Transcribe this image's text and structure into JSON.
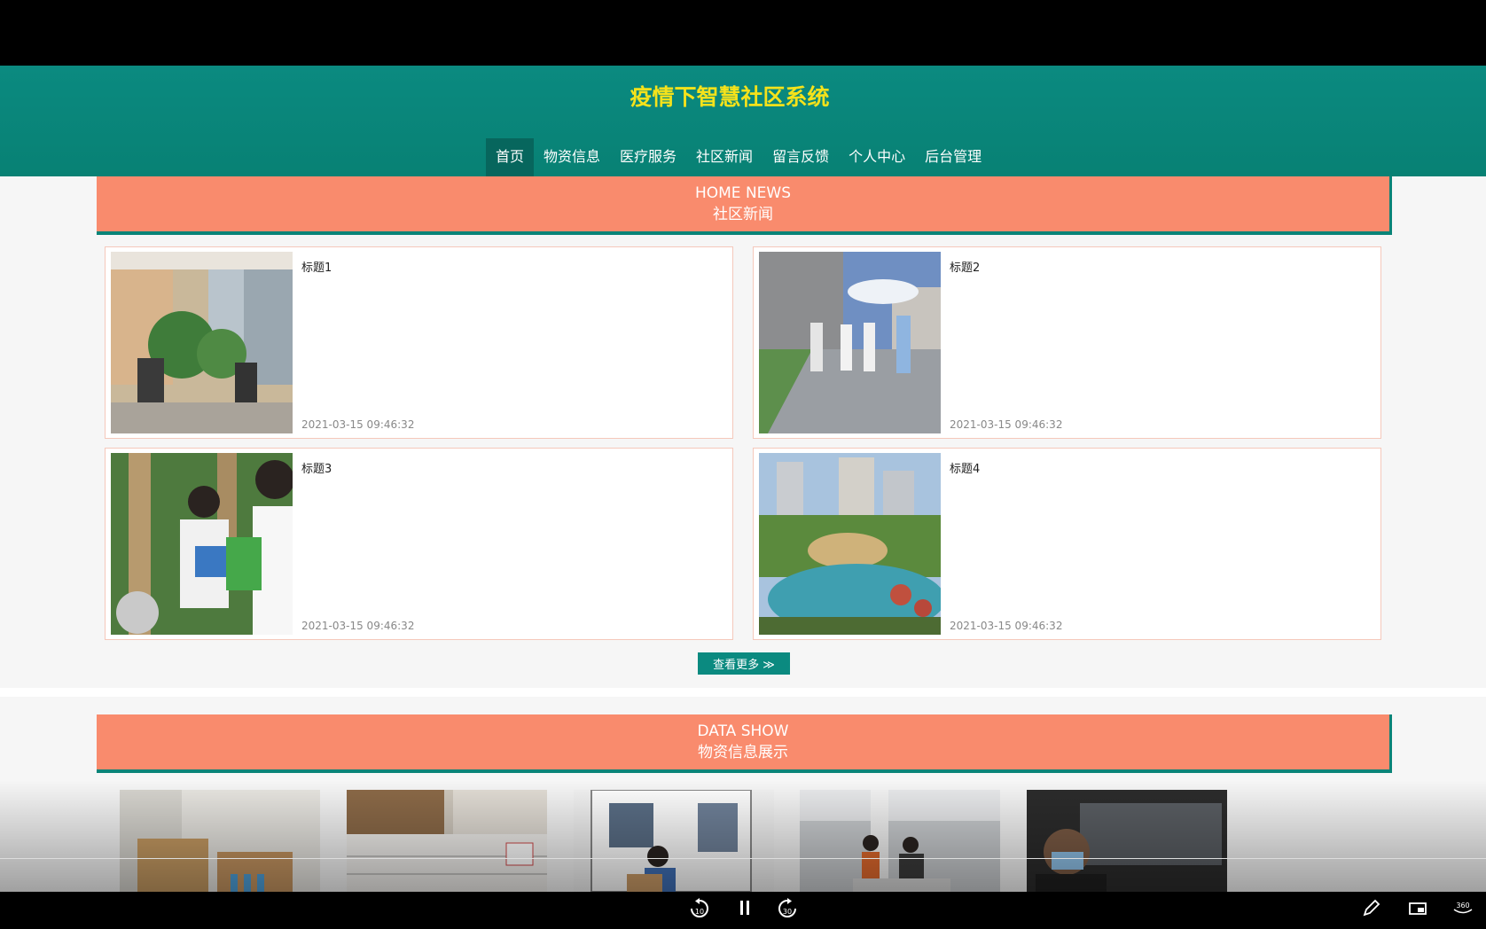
{
  "site": {
    "title": "疫情下智慧社区系统"
  },
  "nav": {
    "items": [
      {
        "label": "首页"
      },
      {
        "label": "物资信息"
      },
      {
        "label": "医疗服务"
      },
      {
        "label": "社区新闻"
      },
      {
        "label": "留言反馈"
      },
      {
        "label": "个人中心"
      },
      {
        "label": "后台管理"
      }
    ],
    "active_index": 0
  },
  "news_section": {
    "en": "HOME NEWS",
    "cn": "社区新闻"
  },
  "news": [
    {
      "title": "标题1",
      "time": "2021-03-15 09:46:32",
      "image": "building-gate-photo"
    },
    {
      "title": "标题2",
      "time": "2021-03-15 09:46:32",
      "image": "people-walking-photo"
    },
    {
      "title": "标题3",
      "time": "2021-03-15 09:46:32",
      "image": "volunteers-photo"
    },
    {
      "title": "标题4",
      "time": "2021-03-15 09:46:32",
      "image": "garden-pond-photo"
    }
  ],
  "more_button": {
    "label": "查看更多 ≫"
  },
  "data_section": {
    "en": "DATA SHOW",
    "cn": "物资信息展示"
  },
  "materials": [
    {
      "image": "boxes-photo"
    },
    {
      "image": "stacked-boxes-photo"
    },
    {
      "image": "van-delivery-photo"
    },
    {
      "image": "workers-photo"
    },
    {
      "image": "masked-person-photo"
    }
  ],
  "player": {
    "rewind_label": "10",
    "forward_label": "30",
    "icons": [
      "rewind-10-icon",
      "pause-icon",
      "forward-30-icon",
      "pen-icon",
      "screen-icon",
      "360-icon"
    ]
  },
  "colors": {
    "header": "#0b8a80",
    "title": "#f5e21b",
    "section": "#f98b6d",
    "accent": "#0b8a80"
  }
}
